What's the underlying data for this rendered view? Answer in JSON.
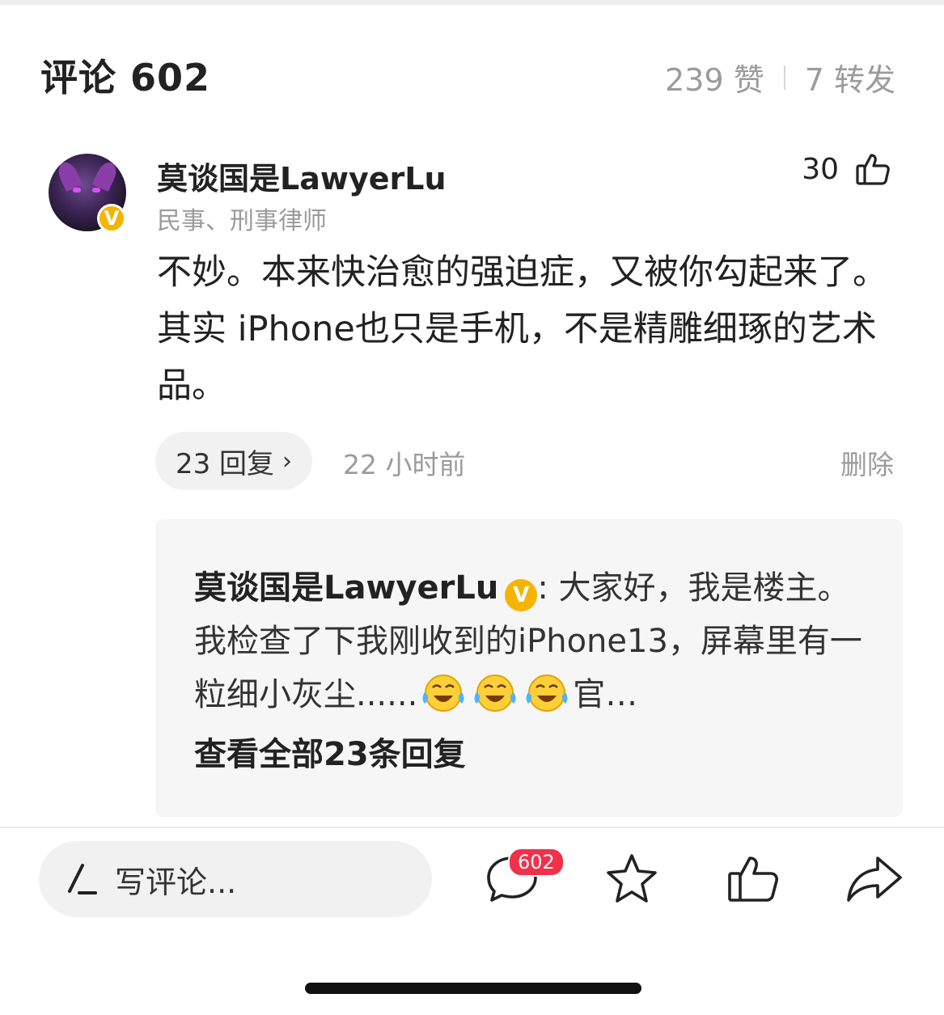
{
  "header": {
    "title": "评论 602",
    "likes": "239 赞",
    "reposts": "7 转发"
  },
  "comment": {
    "username": "莫谈国是LawyerLu",
    "subtitle": "民事、刑事律师",
    "verified_badge": "V",
    "like_count": "30",
    "text": "不妙。本来快治愈的强迫症，又被你勾起来了。其实 iPhone也只是手机，不是精雕细琢的艺术品。",
    "reply_label": "23 回复",
    "time": "22 小时前",
    "delete_label": "删除"
  },
  "reply_preview": {
    "username": "莫谈国是LawyerLu",
    "text_part1": ": 大家好，我是楼主。我检查了下我刚收到的iPhone13，屏幕里有一粒细小灰尘......",
    "text_part2": "官…",
    "view_all": "查看全部23条回复"
  },
  "bottom_bar": {
    "input_placeholder": "写评论...",
    "comment_badge": "602",
    "icons": [
      "pen-icon",
      "comment-icon",
      "star-icon",
      "thumbs-up-icon",
      "share-icon"
    ]
  },
  "colors": {
    "verified": "#f5b400",
    "badge": "#f0314a",
    "muted_text": "#9b9b9b"
  }
}
